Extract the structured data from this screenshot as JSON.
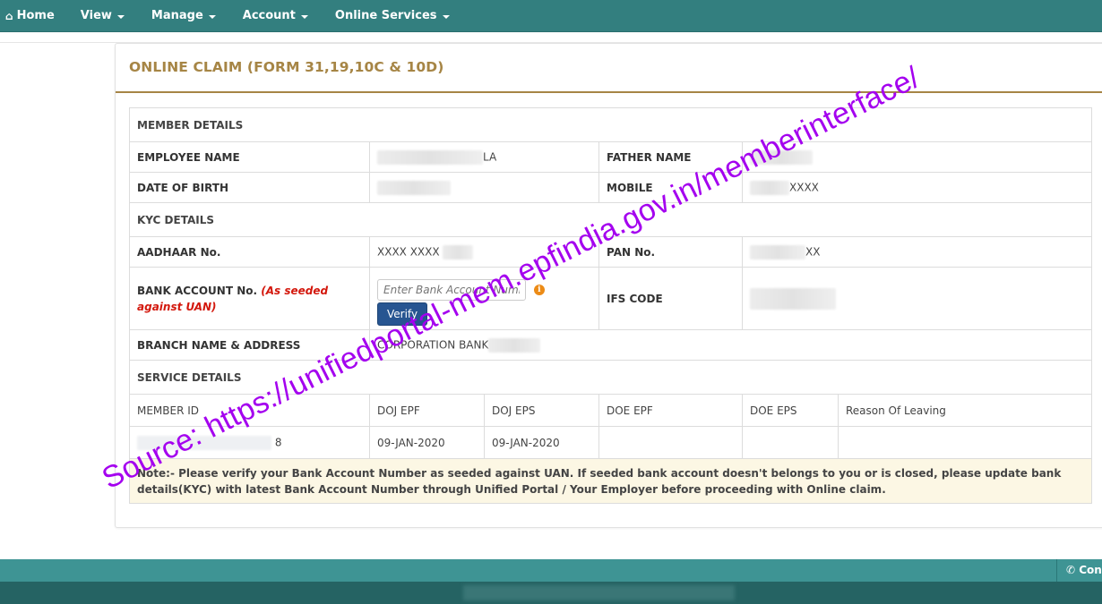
{
  "nav": {
    "items": [
      {
        "label": "Home",
        "icon": "home-icon",
        "dropdown": false
      },
      {
        "label": "View",
        "dropdown": true
      },
      {
        "label": "Manage",
        "dropdown": true
      },
      {
        "label": "Account",
        "dropdown": true
      },
      {
        "label": "Online Services",
        "dropdown": true
      }
    ]
  },
  "page": {
    "title": "ONLINE CLAIM (FORM 31,19,10C & 10D)"
  },
  "member_details": {
    "heading": "MEMBER DETAILS",
    "employee_name_label": "EMPLOYEE NAME",
    "employee_name_value": "LA",
    "father_name_label": "FATHER NAME",
    "father_name_value": "",
    "dob_label": "DATE OF BIRTH",
    "dob_value": "",
    "mobile_label": "MOBILE",
    "mobile_value": "XXXX"
  },
  "kyc_details": {
    "heading": "KYC DETAILS",
    "aadhaar_label": "AADHAAR No.",
    "aadhaar_value": "XXXX XXXX",
    "pan_label": "PAN No.",
    "pan_value": "XX",
    "bank_account_label": "BANK ACCOUNT No.",
    "bank_account_hint": "(As seeded against UAN)",
    "bank_account_placeholder": "Enter Bank Account Number",
    "bank_account_value": "",
    "verify_label": "Verify",
    "info_icon_glyph": "i",
    "ifs_label": "IFS CODE",
    "ifs_value": "",
    "branch_label": "BRANCH NAME & ADDRESS",
    "branch_value": "CORPORATION BANK"
  },
  "service_details": {
    "heading": "SERVICE DETAILS",
    "columns": [
      "MEMBER ID",
      "DOJ EPF",
      "DOJ EPS",
      "DOE EPF",
      "DOE EPS",
      "Reason Of Leaving"
    ],
    "rows": [
      {
        "member_id": "8",
        "doj_epf": "09-JAN-2020",
        "doj_eps": "09-JAN-2020",
        "doe_epf": "",
        "doe_eps": "",
        "reason": ""
      }
    ]
  },
  "note": {
    "text": "Note:- Please verify your Bank Account Number as seeded against UAN. If seeded bank account doesn't belongs to you or is closed, please update bank details(KYC) with latest Bank Account Number through Unified Portal / Your Employer before proceeding with Online claim."
  },
  "footer": {
    "contact_label": "Contact Us"
  },
  "watermark": {
    "text": "Source: https://unifiedportal-mem.epfindia.gov.in/memberinterface/"
  },
  "colors": {
    "nav_bg": "#337f7f",
    "title_gold": "#a68545",
    "hint_red": "#d3180d",
    "verify_blue": "#275591",
    "note_bg": "#fcf7e4",
    "note_text": "#8a6d3b",
    "watermark_purple": "#a400ef"
  }
}
